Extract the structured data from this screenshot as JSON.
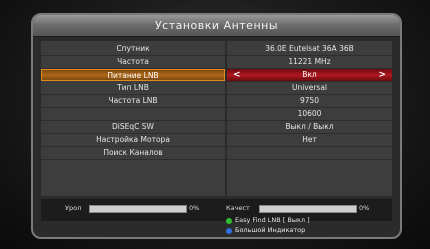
{
  "title": "Установки Антенны",
  "settings": [
    {
      "label": "Спутник",
      "value": "36.0E Eutelsat 36A 36B"
    },
    {
      "label": "Частота",
      "value": "11221 MHz"
    },
    {
      "label": "Питание LNB",
      "value": "Вкл"
    },
    {
      "label": "Тип LNB",
      "value": "Universal"
    },
    {
      "label": "Частота LNB",
      "value": "9750"
    },
    {
      "label": "",
      "value": "10600"
    },
    {
      "label": "DiSEqC SW",
      "value": "Выкл / Выкл"
    },
    {
      "label": "Настройка Мотора",
      "value": "Нет"
    },
    {
      "label": "Поиск Каналов",
      "value": ""
    }
  ],
  "arrows": {
    "left": "<",
    "right": ">"
  },
  "signal": {
    "level_label": "Урол",
    "level_value": "0%",
    "level_fraction": 0,
    "quality_label": "Качест",
    "quality_value": "0%",
    "quality_fraction": 0
  },
  "legend": [
    {
      "color": "#2fbf2f",
      "text": "Easy Find LNB [ Выкл ]"
    },
    {
      "color": "#2f6fdf",
      "text": "Большой Индикатор"
    }
  ]
}
